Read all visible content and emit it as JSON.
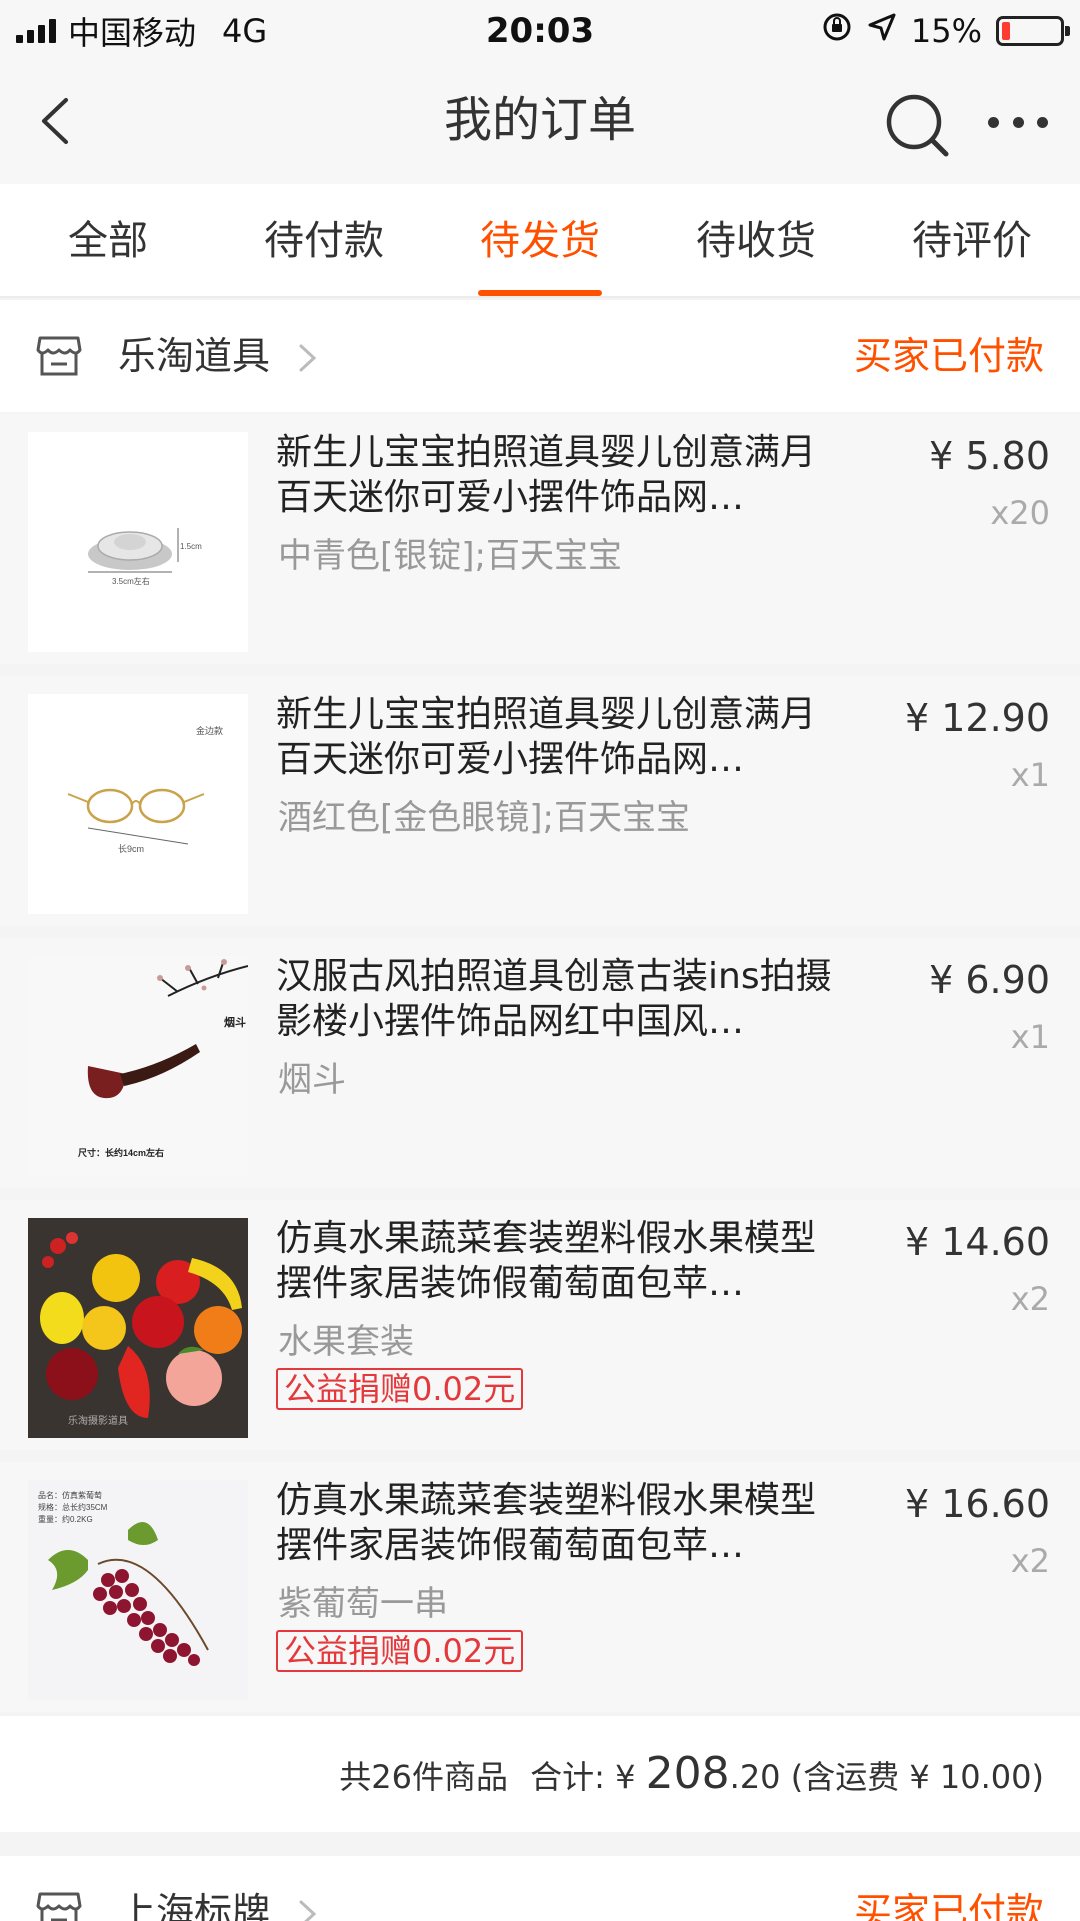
{
  "status_bar": {
    "carrier": "中国移动",
    "network": "4G",
    "time": "20:03",
    "battery": "15%",
    "battery_level": 0.15,
    "battery_color": "#ff3b30"
  },
  "nav": {
    "title": "我的订单",
    "back_icon": "chevron-left-icon",
    "search_icon": "search-icon",
    "more_icon": "more-dots-icon"
  },
  "tabs": [
    {
      "label": "全部",
      "active": false
    },
    {
      "label": "待付款",
      "active": false
    },
    {
      "label": "待发货",
      "active": true
    },
    {
      "label": "待收货",
      "active": false
    },
    {
      "label": "待评价",
      "active": false
    }
  ],
  "accent_color": "#ff5000",
  "orders": [
    {
      "shop": "乐淘道具",
      "status": "买家已付款",
      "items": [
        {
          "title": "新生儿宝宝拍照道具婴儿创意满月百天迷你可爱小摆件饰品网…",
          "spec": "中青色[银锭];百天宝宝",
          "price": "¥ 5.80",
          "qty": "x20",
          "badge": "",
          "thumb_labels": [
            "1.5cm",
            "3.5cm左右"
          ]
        },
        {
          "title": "新生儿宝宝拍照道具婴儿创意满月百天迷你可爱小摆件饰品网…",
          "spec": "酒红色[金色眼镜];百天宝宝",
          "price": "¥ 12.90",
          "qty": "x1",
          "badge": "",
          "thumb_labels": [
            "金边款",
            "长9cm"
          ]
        },
        {
          "title": "汉服古风拍照道具创意古装ins拍摄影楼小摆件饰品网红中国风…",
          "spec": "烟斗",
          "price": "¥ 6.90",
          "qty": "x1",
          "badge": "",
          "thumb_labels": [
            "烟斗",
            "尺寸：长约14cm左右"
          ]
        },
        {
          "title": "仿真水果蔬菜套装塑料假水果模型摆件家居装饰假葡萄面包苹…",
          "spec": "水果套装",
          "price": "¥ 14.60",
          "qty": "x2",
          "badge": "公益捐赠0.02元",
          "thumb_labels": [
            "乐淘摄影道具"
          ]
        },
        {
          "title": "仿真水果蔬菜套装塑料假水果模型摆件家居装饰假葡萄面包苹…",
          "spec": "紫葡萄一串",
          "price": "¥ 16.60",
          "qty": "x2",
          "badge": "公益捐赠0.02元",
          "thumb_labels": [
            "品名：仿真紫葡萄",
            "规格：总长约35CM",
            "重量：约0.2KG"
          ]
        }
      ],
      "summary": {
        "count_text": "共26件商品",
        "total_label": "合计: ¥ ",
        "total_int": "208",
        "total_dec": ".20",
        "shipping_text": " (含运费 ¥ 10.00)"
      }
    },
    {
      "shop": "上海标牌",
      "status": "买家已付款"
    }
  ]
}
